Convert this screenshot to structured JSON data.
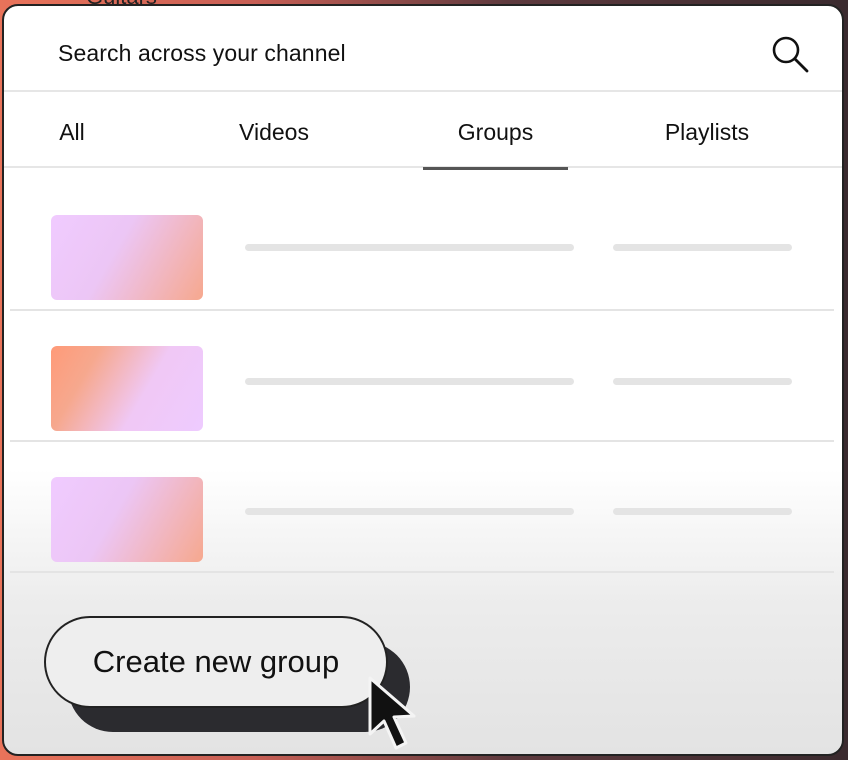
{
  "background": {
    "peek_text": "Guitars"
  },
  "search": {
    "placeholder": "Search across your channel",
    "icon": "search-icon"
  },
  "tabs": [
    {
      "label": "All",
      "active": false
    },
    {
      "label": "Videos",
      "active": false
    },
    {
      "label": "Groups",
      "active": true
    },
    {
      "label": "Playlists",
      "active": false
    }
  ],
  "list": {
    "rows": [
      {
        "thumbnail_style": "pink-to-orange"
      },
      {
        "thumbnail_style": "orange-to-pink"
      },
      {
        "thumbnail_style": "pink-to-orange"
      }
    ]
  },
  "actions": {
    "create_label": "Create new group"
  },
  "colors": {
    "accent_underline": "#555555",
    "thumb_pink": "#f0cbff",
    "thumb_orange": "#f6a88e",
    "button_shadow": "#2b2b2f"
  }
}
